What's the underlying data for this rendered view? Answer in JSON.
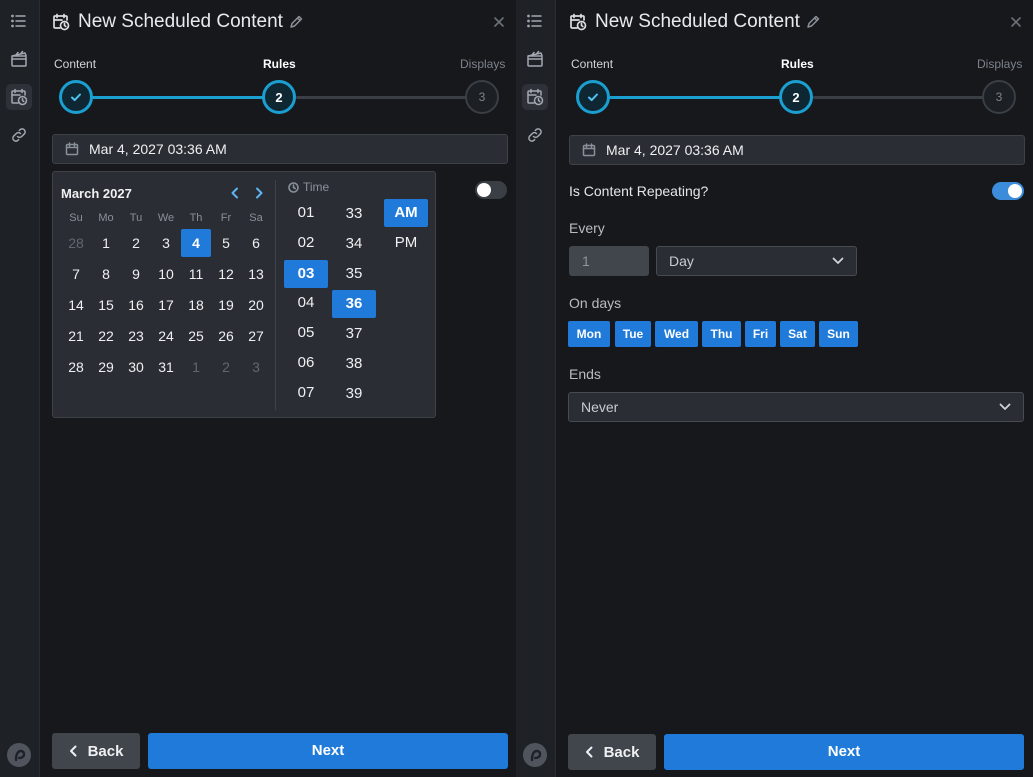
{
  "rail": {
    "items": [
      {
        "icon": "list-icon"
      },
      {
        "icon": "clapperboard-icon"
      },
      {
        "icon": "calendar-clock-icon"
      },
      {
        "icon": "link-icon"
      }
    ],
    "logo_icon": "brand-logo-icon"
  },
  "left": {
    "title": "New Scheduled Content",
    "steps": [
      {
        "label": "Content",
        "state": "done"
      },
      {
        "label": "Rules",
        "state": "current",
        "number": "2"
      },
      {
        "label": "Displays",
        "state": "todo",
        "number": "3"
      }
    ],
    "datetime_value": "Mar 4, 2027 03:36 AM",
    "repeat_toggle_on": false,
    "calendar": {
      "month_label": "March 2027",
      "weekdays": [
        "Su",
        "Mo",
        "Tu",
        "We",
        "Th",
        "Fr",
        "Sa"
      ],
      "weeks": [
        [
          "28",
          "1",
          "2",
          "3",
          "4",
          "5",
          "6"
        ],
        [
          "7",
          "8",
          "9",
          "10",
          "11",
          "12",
          "13"
        ],
        [
          "14",
          "15",
          "16",
          "17",
          "18",
          "19",
          "20"
        ],
        [
          "21",
          "22",
          "23",
          "24",
          "25",
          "26",
          "27"
        ],
        [
          "28",
          "29",
          "30",
          "31",
          "1",
          "2",
          "3"
        ]
      ],
      "selected_day": "4"
    },
    "time": {
      "label": "Time",
      "hours": [
        "01",
        "02",
        "03",
        "04",
        "05",
        "06",
        "07"
      ],
      "minutes": [
        "33",
        "34",
        "35",
        "36",
        "37",
        "38",
        "39"
      ],
      "periods": [
        "AM",
        "PM"
      ],
      "selected_hour": "03",
      "selected_minute": "36",
      "selected_period": "AM"
    },
    "back_label": "Back",
    "next_label": "Next"
  },
  "right": {
    "title": "New Scheduled Content",
    "steps": [
      {
        "label": "Content",
        "state": "done"
      },
      {
        "label": "Rules",
        "state": "current",
        "number": "2"
      },
      {
        "label": "Displays",
        "state": "todo",
        "number": "3"
      }
    ],
    "datetime_value": "Mar 4, 2027 03:36 AM",
    "repeating_label": "Is Content Repeating?",
    "repeat_toggle_on": true,
    "every_label": "Every",
    "every_value": "1",
    "every_unit": "Day",
    "on_days_label": "On days",
    "days": [
      "Mon",
      "Tue",
      "Wed",
      "Thu",
      "Fri",
      "Sat",
      "Sun"
    ],
    "ends_label": "Ends",
    "ends_value": "Never",
    "back_label": "Back",
    "next_label": "Next"
  },
  "colors": {
    "accent": "#1f7ad9",
    "step_accent": "#1a9fd0",
    "background": "#16181c",
    "rail": "#1e2126"
  }
}
